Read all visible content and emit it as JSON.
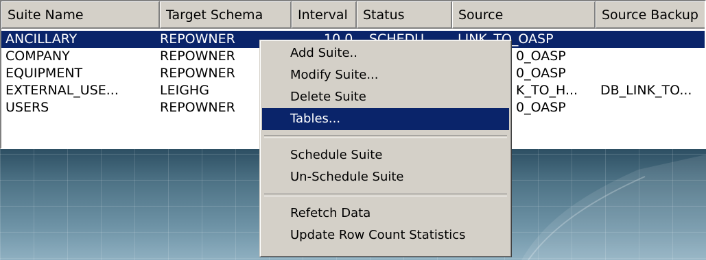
{
  "list": {
    "columns": [
      "Suite Name",
      "Target Schema",
      "Interval",
      "Status",
      "Source",
      "Source Backup"
    ],
    "rows": [
      {
        "suite_name": "ANCILLARY",
        "target_schema": "REPOWNER",
        "interval": "10.0",
        "status": "SCHEDU...",
        "source": "LINK_TO_OASP",
        "source_backup": "",
        "selected": true
      },
      {
        "suite_name": "COMPANY",
        "target_schema": "REPOWNER",
        "source": "0_OASP",
        "source_backup": ""
      },
      {
        "suite_name": "EQUIPMENT",
        "target_schema": "REPOWNER",
        "source": "0_OASP",
        "source_backup": ""
      },
      {
        "suite_name": "EXTERNAL_USE...",
        "target_schema": "LEIGHG",
        "source": "K_TO_H...",
        "source_backup": "DB_LINK_TO..."
      },
      {
        "suite_name": "USERS",
        "target_schema": "REPOWNER",
        "source": "0_OASP",
        "source_backup": ""
      }
    ]
  },
  "context_menu": {
    "items": [
      {
        "label": "Add Suite..",
        "highlighted": false
      },
      {
        "label": "Modify Suite...",
        "highlighted": false
      },
      {
        "label": "Delete Suite",
        "highlighted": false
      },
      {
        "label": "Tables...",
        "highlighted": true
      },
      {
        "label": "Schedule Suite",
        "highlighted": false
      },
      {
        "label": "Un-Schedule Suite",
        "highlighted": false
      },
      {
        "label": "Refetch Data",
        "highlighted": false
      },
      {
        "label": "Update Row Count Statistics",
        "highlighted": false
      }
    ]
  },
  "colors": {
    "selection": "#0a246a",
    "face": "#d4d0c8",
    "window": "#ffffff"
  }
}
